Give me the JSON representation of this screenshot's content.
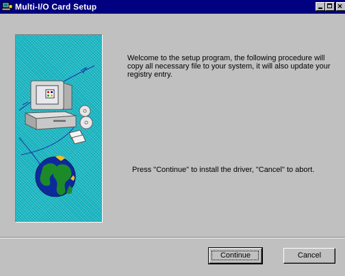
{
  "window": {
    "title": "Multi-I/O Card Setup",
    "title_bar_color": "#000080",
    "icon": "setup-computer-icon"
  },
  "title_buttons": {
    "minimize": "minimize-icon",
    "maximize": "maximize-icon",
    "close": "close-icon"
  },
  "illustration": {
    "description_icon": "computer-globe-illustration",
    "background_color": "#16b8c4"
  },
  "content": {
    "welcome_text": "Welcome to the setup program, the following procedure will copy all necessary file to your system, it will also update your registry entry.",
    "instruction_text": "Press \"Continue\" to install the driver, \"Cancel\" to abort."
  },
  "buttons": {
    "continue_label": "Continue",
    "cancel_label": "Cancel"
  }
}
